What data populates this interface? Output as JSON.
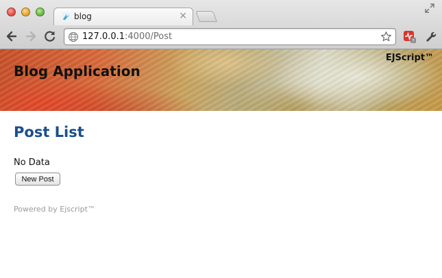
{
  "browser": {
    "tab": {
      "title": "blog"
    },
    "address": {
      "host": "127.0.0.1",
      "port_and_path": ":4000/Post"
    },
    "icons": {
      "back": "arrow-left-icon",
      "forward": "arrow-right-icon",
      "reload": "reload-icon",
      "globe": "globe-icon",
      "bookmark": "star-icon",
      "extension": "extension-icon",
      "menu": "wrench-icon",
      "close_tab": "close-icon"
    }
  },
  "page": {
    "banner": {
      "title": "Blog Application",
      "brand": "EJScript™"
    },
    "heading": "Post List",
    "empty_message": "No Data",
    "new_post_label": "New Post",
    "footer": "Powered by Ejscript™"
  },
  "colors": {
    "heading": "#1a4f8c",
    "footer": "#9a9a9a"
  }
}
